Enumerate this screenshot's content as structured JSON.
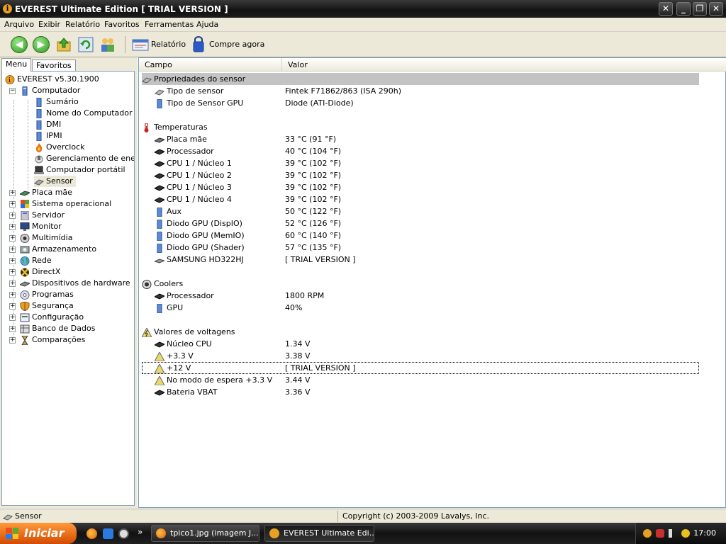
{
  "window": {
    "title": "EVEREST Ultimate Edition  [ TRIAL VERSION ]",
    "btn_close": "✕",
    "btn_min": "_",
    "btn_restore": "❐"
  },
  "menu": [
    "Arquivo",
    "Exibir",
    "Relatório",
    "Favoritos",
    "Ferramentas",
    "Ajuda"
  ],
  "toolbar": {
    "report_label": "Relatório",
    "buy_label": "Compre agora"
  },
  "tabs": {
    "menu": "Menu",
    "favorites": "Favoritos"
  },
  "tree": {
    "root": "EVEREST v5.30.1900",
    "computer": "Computador",
    "computer_children": [
      "Sumário",
      "Nome do Computador",
      "DMI",
      "IPMI",
      "Overclock",
      "Gerenciamento de energi",
      "Computador portátil",
      "Sensor"
    ],
    "top_items": [
      "Placa mãe",
      "Sistema operacional",
      "Servidor",
      "Monitor",
      "Multimídia",
      "Armazenamento",
      "Rede",
      "DirectX",
      "Dispositivos de hardware",
      "Programas",
      "Segurança",
      "Configuração",
      "Banco de Dados",
      "Comparações"
    ]
  },
  "columns": {
    "field": "Campo",
    "value": "Valor"
  },
  "sections": {
    "sensor_props": {
      "title": "Propriedades do sensor",
      "rows": [
        {
          "field": "Tipo de sensor",
          "value": "Fintek F71862/863  (ISA 290h)"
        },
        {
          "field": "Tipo de Sensor GPU",
          "value": "Diode  (ATI-Diode)"
        }
      ]
    },
    "temps": {
      "title": "Temperaturas",
      "rows": [
        {
          "field": "Placa mãe",
          "value": "33 °C  (91 °F)"
        },
        {
          "field": "Processador",
          "value": "40 °C  (104 °F)"
        },
        {
          "field": "CPU 1 / Núcleo 1",
          "value": "39 °C  (102 °F)"
        },
        {
          "field": "CPU 1 / Núcleo 2",
          "value": "39 °C  (102 °F)"
        },
        {
          "field": "CPU 1 / Núcleo 3",
          "value": "39 °C  (102 °F)"
        },
        {
          "field": "CPU 1 / Núcleo 4",
          "value": "39 °C  (102 °F)"
        },
        {
          "field": "Aux",
          "value": "50 °C  (122 °F)"
        },
        {
          "field": "Diodo GPU (DispIO)",
          "value": "52 °C  (126 °F)"
        },
        {
          "field": "Diodo GPU (MemIO)",
          "value": "60 °C  (140 °F)"
        },
        {
          "field": "Diodo GPU (Shader)",
          "value": "57 °C  (135 °F)"
        },
        {
          "field": "SAMSUNG HD322HJ",
          "value": "[ TRIAL VERSION ]"
        }
      ]
    },
    "coolers": {
      "title": "Coolers",
      "rows": [
        {
          "field": "Processador",
          "value": "1800 RPM"
        },
        {
          "field": "GPU",
          "value": "40%"
        }
      ]
    },
    "volts": {
      "title": "Valores de voltagens",
      "rows": [
        {
          "field": "Núcleo CPU",
          "value": "1.34 V"
        },
        {
          "field": "+3.3 V",
          "value": "3.38 V"
        },
        {
          "field": "+12 V",
          "value": "[ TRIAL VERSION ]"
        },
        {
          "field": "No modo de espera +3.3 V",
          "value": "3.44 V"
        },
        {
          "field": "Bateria VBAT",
          "value": "3.36 V"
        }
      ]
    }
  },
  "status": {
    "left": "Sensor",
    "right": "Copyright (c) 2003-2009 Lavalys, Inc."
  },
  "taskbar": {
    "start": "Iniciar",
    "more": "»",
    "tasks": [
      "tpico1.jpg (imagem J...",
      "EVEREST Ultimate Edi..."
    ],
    "clock": "17:00"
  },
  "colors": {
    "xp_blue": "#7f9db9",
    "selected_row": "#c3c3c3",
    "start_orange": "#e06a12"
  }
}
